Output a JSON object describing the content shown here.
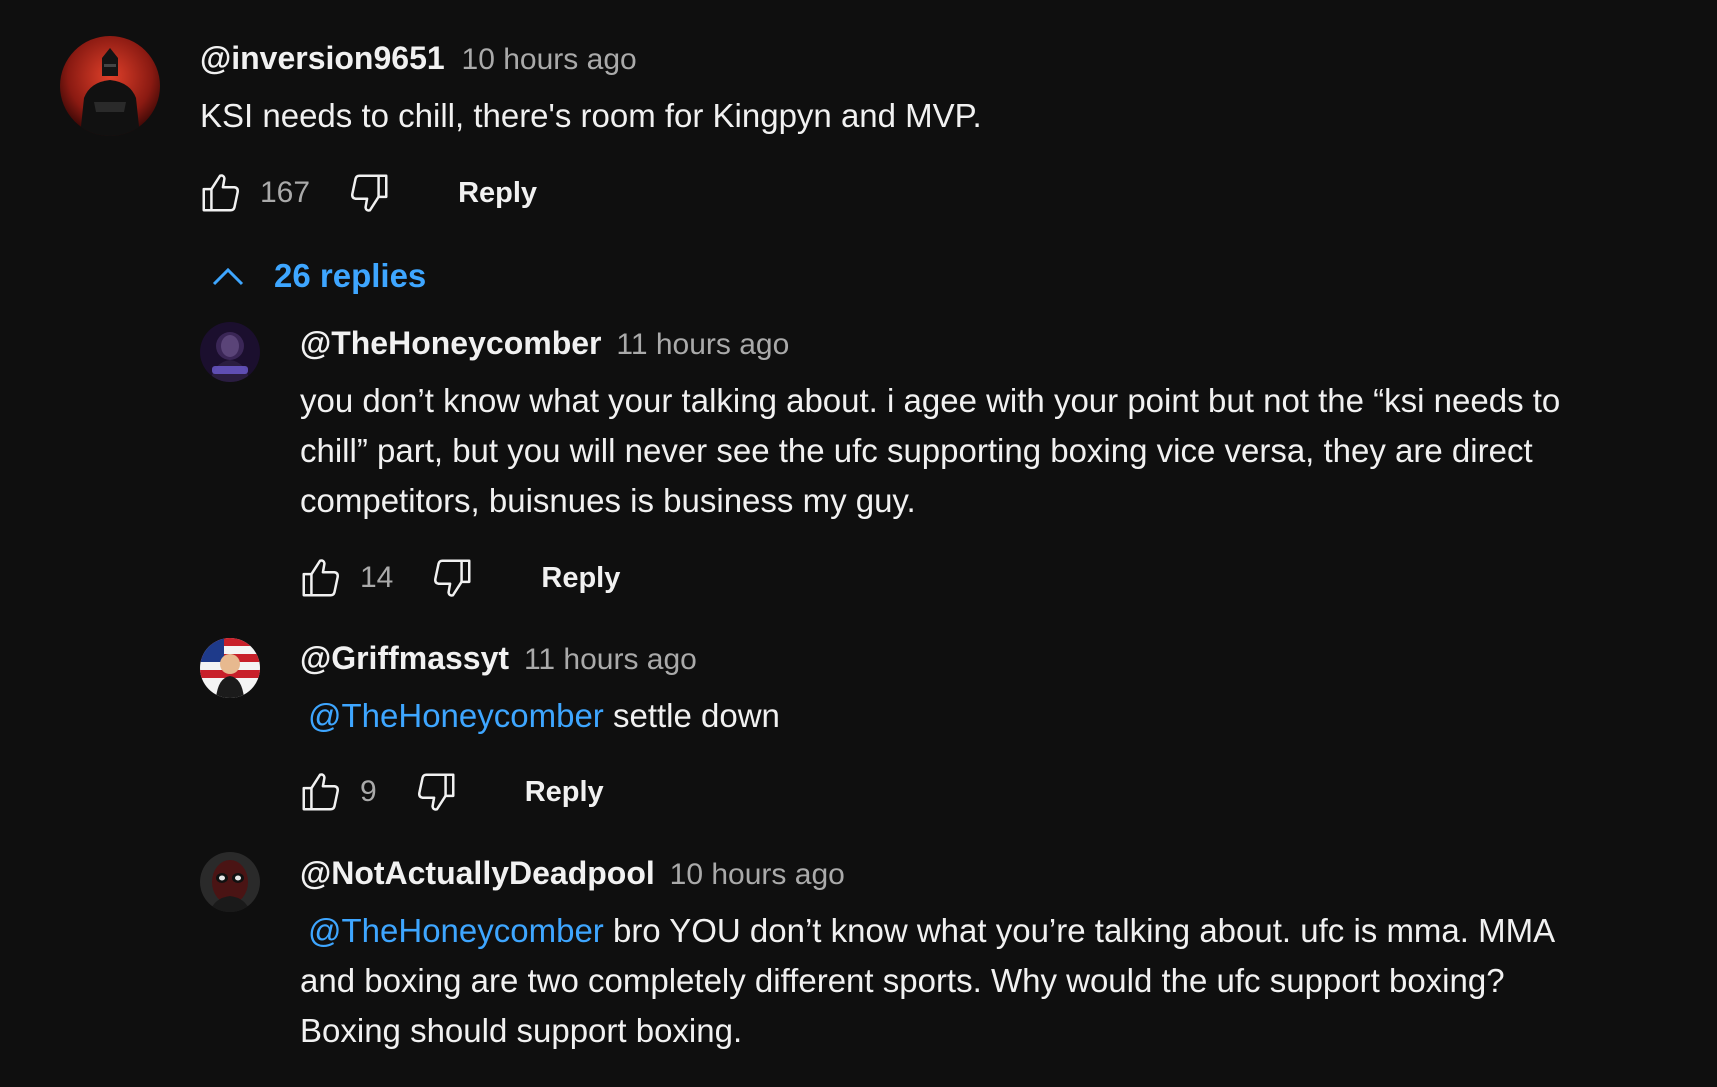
{
  "top_comment": {
    "author": "@inversion9651",
    "time": "10 hours ago",
    "text": "KSI needs to chill, there's room for Kingpyn and MVP.",
    "likes": "167",
    "reply_label": "Reply"
  },
  "replies_toggle": {
    "label": "26 replies",
    "icon": "chevron-up-icon"
  },
  "replies": [
    {
      "author": "@TheHoneycomber",
      "time": "11 hours ago",
      "lines": [
        "you don’t know what your talking about. i agee with your point but not the “ksi needs to",
        "chill” part, but you will never see the ufc supporting boxing vice versa, they are direct",
        "competitors, buisnues is business my guy."
      ],
      "likes": "14",
      "reply_label": "Reply"
    },
    {
      "author": "@Griffmassyt",
      "time": "11 hours ago",
      "mention": "@TheHoneycomber",
      "text": "settle down",
      "likes": "9",
      "reply_label": "Reply"
    },
    {
      "author": "@NotActuallyDeadpool",
      "time": "10 hours ago",
      "mention": "@TheHoneycomber",
      "line1": "bro YOU don’t know what you’re talking about. ufc is mma. MMA",
      "line2": "and boxing are two completely different sports. Why would the ufc support boxing?",
      "line3": "Boxing should support boxing."
    }
  ],
  "colors": {
    "background": "#0f0f0f",
    "text": "#f1f1f1",
    "secondary": "#aaaaaa",
    "link": "#3ea6ff"
  }
}
